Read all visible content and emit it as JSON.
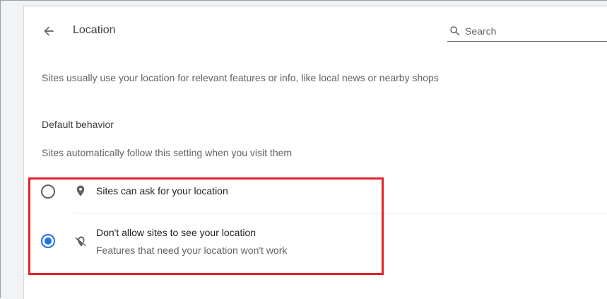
{
  "header": {
    "title": "Location",
    "back_icon": "arrow-back-icon",
    "search_placeholder": "Search",
    "search_value": ""
  },
  "description": "Sites usually use your location for relevant features or info, like local news or nearby shops",
  "default_behavior": {
    "heading": "Default behavior",
    "subtitle": "Sites automatically follow this setting when you visit them",
    "options": [
      {
        "label": "Sites can ask for your location",
        "sublabel": "",
        "icon": "location-pin-icon",
        "selected": false
      },
      {
        "label": "Don't allow sites to see your location",
        "sublabel": "Features that need your location won't work",
        "icon": "location-off-icon",
        "selected": true
      }
    ]
  },
  "colors": {
    "accent": "#1a73e8",
    "highlight": "#e5212b",
    "text_primary": "#202124",
    "text_secondary": "#5f6368"
  }
}
